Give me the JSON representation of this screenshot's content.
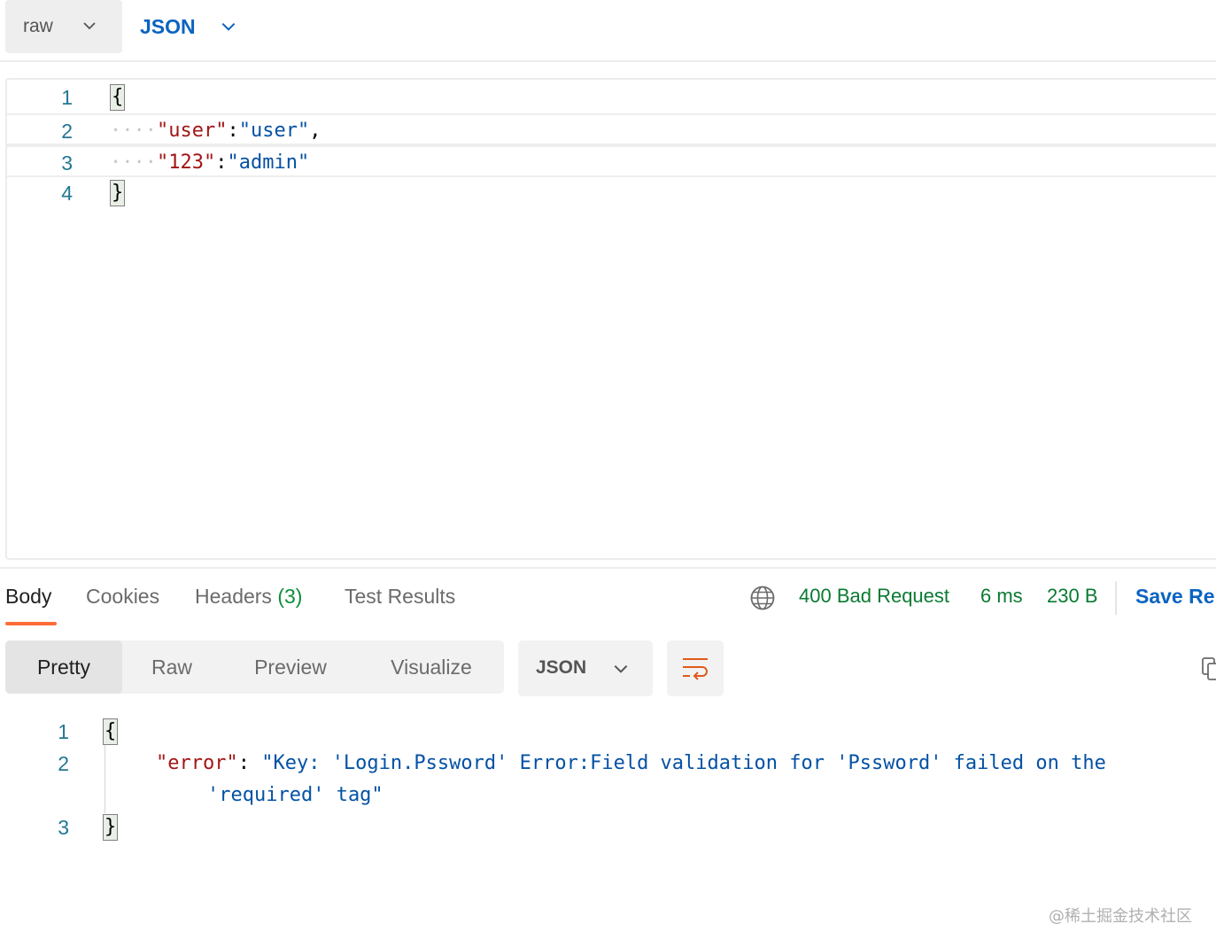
{
  "request_toolbar": {
    "body_type": "raw",
    "language": "JSON"
  },
  "request_editor": {
    "line_numbers": [
      "1",
      "2",
      "3",
      "4"
    ],
    "open_brace": "{",
    "close_brace": "}",
    "line2": {
      "key": "\"user\"",
      "colon": ":",
      "value": "\"user\"",
      "comma": ","
    },
    "line3": {
      "key": "\"123\"",
      "colon": ":",
      "value": "\"admin\""
    }
  },
  "response_tabs": {
    "body": "Body",
    "cookies": "Cookies",
    "headers": "Headers",
    "headers_count": "(3)",
    "test_results": "Test Results"
  },
  "response_status": {
    "status": "400 Bad Request",
    "time": "6 ms",
    "size": "230 B",
    "save_label": "Save Re"
  },
  "response_view": {
    "modes": [
      "Pretty",
      "Raw",
      "Preview",
      "Visualize"
    ],
    "active_mode": "Pretty",
    "format": "JSON"
  },
  "response_body": {
    "line_numbers": [
      "1",
      "2",
      "3"
    ],
    "open_brace": "{",
    "close_brace": "}",
    "key": "\"error\"",
    "colon": ": ",
    "value_line1": "\"Key: 'Login.Pssword' Error:Field validation for 'Pssword' failed on the",
    "value_line2": "'required' tag\""
  },
  "watermark": "@稀土掘金技术社区",
  "colors": {
    "accent_blue": "#0b63c1",
    "status_green": "#0a7a32",
    "tab_underline_orange": "#ff6c37",
    "json_key": "#a31515",
    "json_string": "#0451a5",
    "line_number": "#237893"
  }
}
